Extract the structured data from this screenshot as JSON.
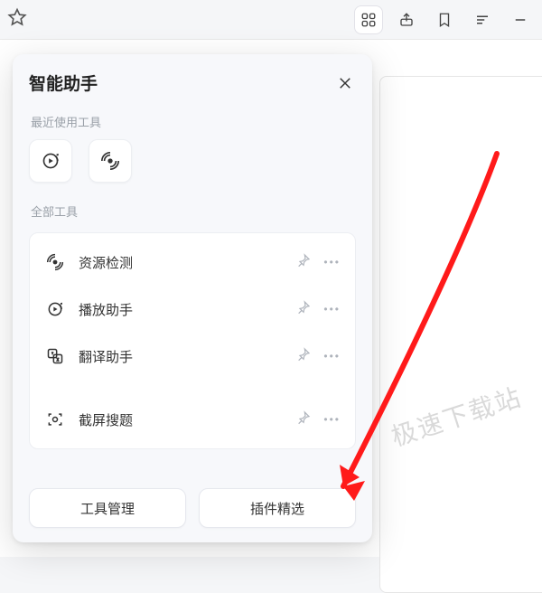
{
  "toolbar": {
    "star_title": "收藏",
    "icons": [
      "grid",
      "share",
      "bookmark",
      "menu",
      "minimize"
    ]
  },
  "panel": {
    "title": "智能助手",
    "recent_label": "最近使用工具",
    "all_label": "全部工具",
    "recent": [
      {
        "icon": "play-refresh",
        "name": "播放助手"
      },
      {
        "icon": "radar",
        "name": "资源检测"
      }
    ],
    "tools": [
      {
        "icon": "radar",
        "name": "资源检测"
      },
      {
        "icon": "play-refresh",
        "name": "播放助手"
      },
      {
        "icon": "translate",
        "name": "翻译助手"
      },
      {
        "icon": "capture",
        "name": "截屏搜题"
      }
    ],
    "footer": {
      "manage": "工具管理",
      "featured": "插件精选"
    }
  },
  "watermark": "极速下载站"
}
